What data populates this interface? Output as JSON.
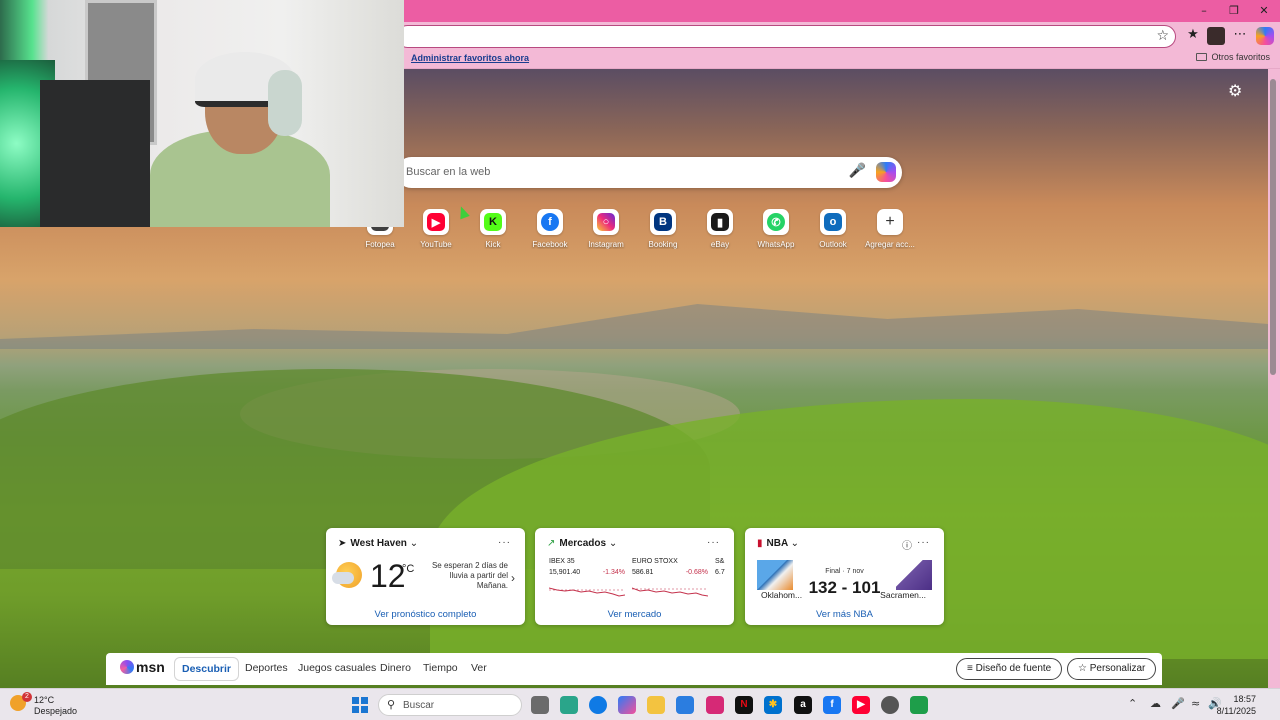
{
  "window": {
    "minimize_icon": "minimize-icon",
    "restore_icon": "restore-icon",
    "close_icon": "close-icon"
  },
  "toolbar": {
    "favorite_star_icon": "star-icon",
    "favorites_icon": "favorites-icon",
    "more_icon": "ellipsis-icon",
    "copilot_icon": "copilot-icon"
  },
  "favorites_bar": {
    "manage_link": "Administrar favoritos ahora",
    "other_favorites": "Otros favoritos"
  },
  "newtab": {
    "settings_icon": "gear-icon",
    "search_placeholder": "Buscar en la web",
    "quick_links": [
      {
        "label": "Fotopea",
        "color": "#3f3f3f"
      },
      {
        "label": "YouTube",
        "color": "#ff0033"
      },
      {
        "label": "Kick",
        "color": "#53fc18"
      },
      {
        "label": "Facebook",
        "color": "#1877f2"
      },
      {
        "label": "Instagram",
        "color": "#d62976"
      },
      {
        "label": "Booking",
        "color": "#003580"
      },
      {
        "label": "eBay",
        "color": "#1a1a1a"
      },
      {
        "label": "WhatsApp",
        "color": "#25d366"
      },
      {
        "label": "Outlook",
        "color": "#0f6cbd"
      },
      {
        "label": "Agregar acc...",
        "color": "#ffffff"
      }
    ]
  },
  "cards": {
    "weather": {
      "title": "West Haven",
      "temp": "12",
      "unit": "°C",
      "note": "Se esperan 2 días de lluvia a partir del Mañana.",
      "link": "Ver pronóstico completo"
    },
    "markets": {
      "title": "Mercados",
      "items": [
        {
          "name": "IBEX 35",
          "value": "15,901.40",
          "change": "-1.34%"
        },
        {
          "name": "EURO STOXX",
          "value": "586.81",
          "change": "-0.68%"
        },
        {
          "name": "S&",
          "value": "6.7",
          "change": ""
        }
      ],
      "link": "Ver mercado"
    },
    "nba": {
      "title": "NBA",
      "status": "Final · 7 nov",
      "score": "132 - 101",
      "team_left": "Oklahom...",
      "team_right": "Sacramen...",
      "link": "Ver más NBA"
    }
  },
  "msn": {
    "logo": "msn",
    "nav": [
      "Descubrir",
      "Deportes",
      "Juegos casuales",
      "Dinero",
      "Tiempo",
      "Ver"
    ],
    "font_button": "Diseño de fuente",
    "personalize_button": "Personalizar"
  },
  "taskbar": {
    "weather_temp": "12°C",
    "weather_cond": "Despejado",
    "weather_badge": "2",
    "search_label": "Buscar",
    "time": "18:57",
    "date": "8/11/2025"
  },
  "colors": {
    "titlebar": "#ec5da3",
    "toolbar": "#f3b9d6",
    "link": "#1a5fb4",
    "negative": "#c4314b"
  }
}
